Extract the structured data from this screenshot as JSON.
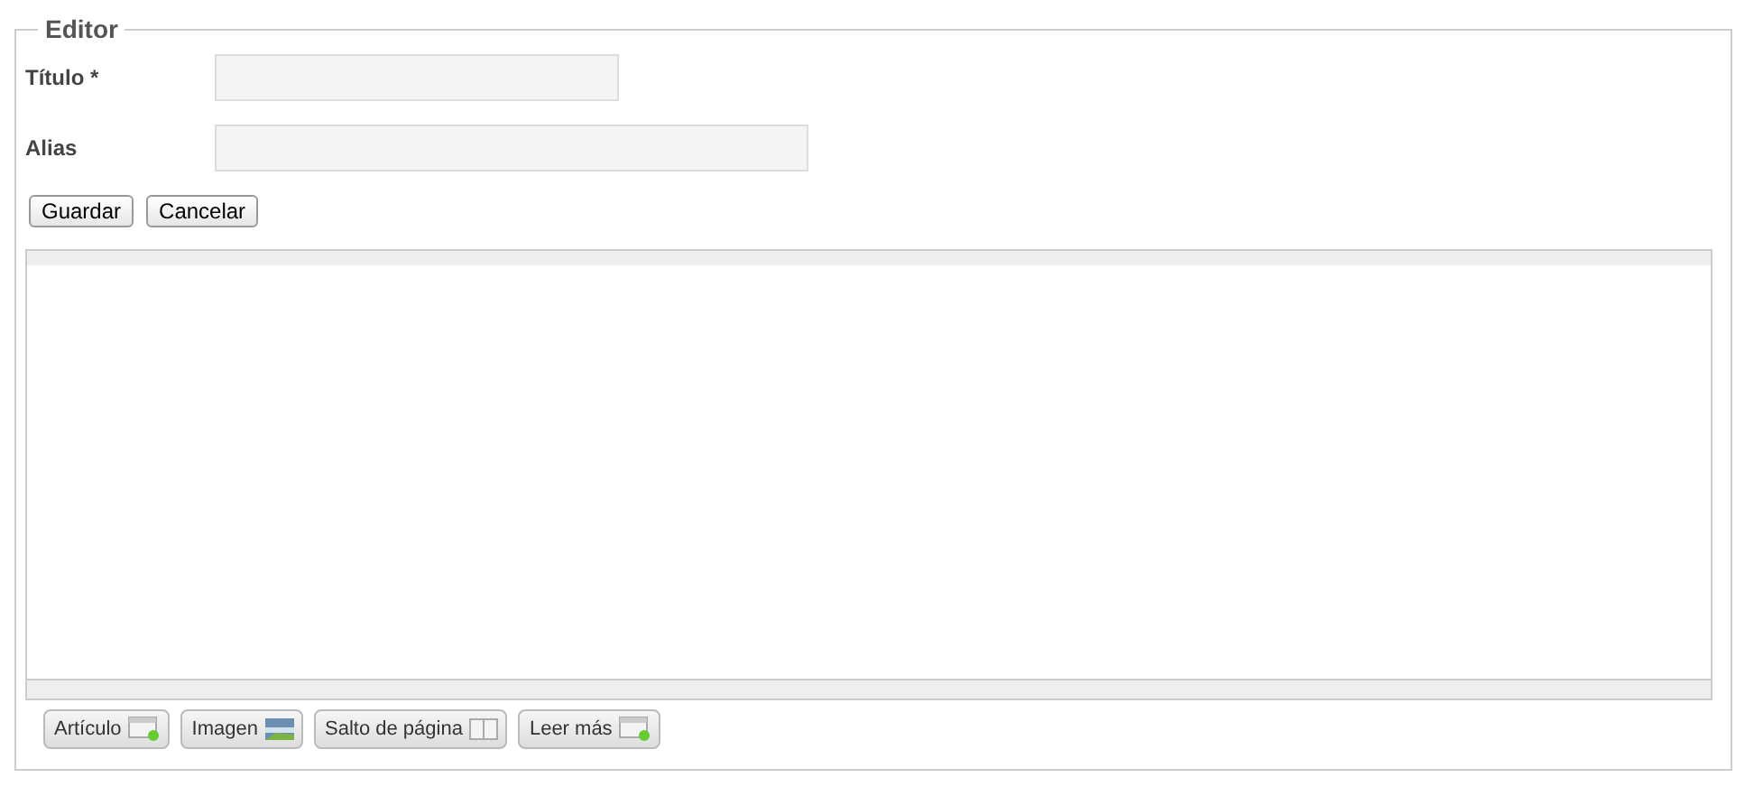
{
  "panel": {
    "title": "Editor"
  },
  "fields": [
    {
      "label": "Título *"
    },
    {
      "label": "Alias"
    }
  ],
  "actions": [
    "Guardar",
    "Cancelar"
  ],
  "editor_buttons": [
    {
      "label": "Artículo",
      "kind": "article"
    },
    {
      "label": "Imagen",
      "kind": "image"
    },
    {
      "label": "Salto de página",
      "kind": "pagebreak"
    },
    {
      "label": "Leer más",
      "kind": "readmore"
    }
  ]
}
